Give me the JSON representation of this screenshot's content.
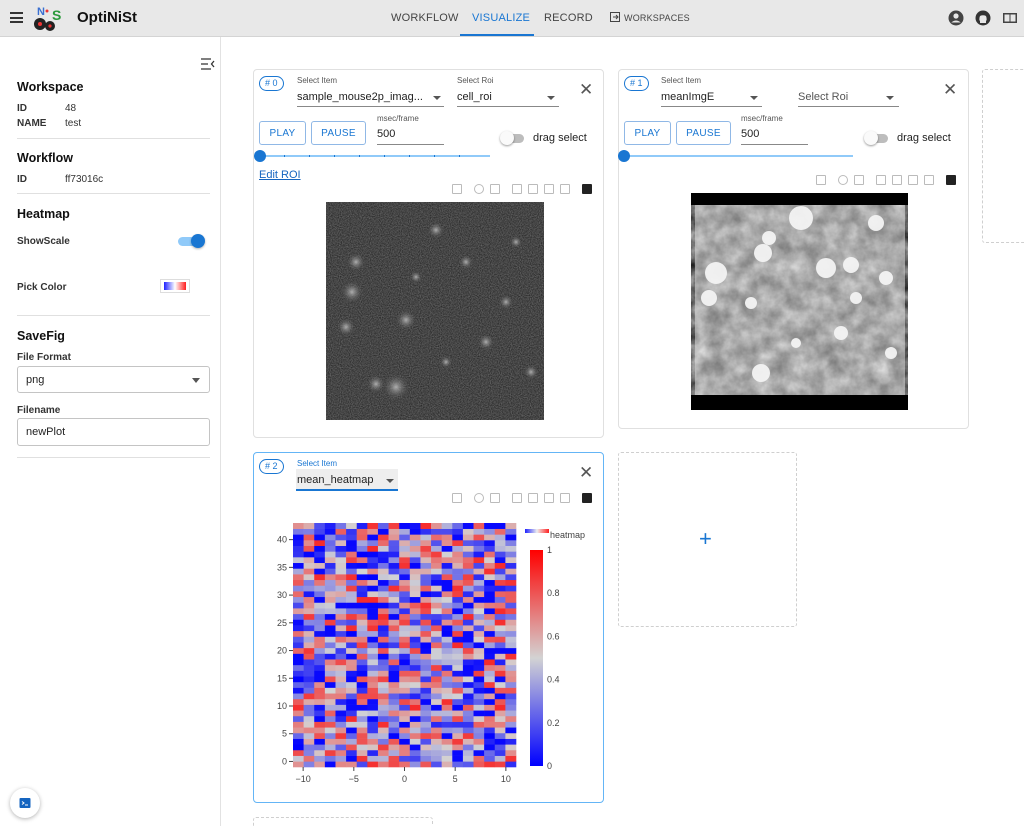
{
  "header": {
    "app_title": "OptiNiSt",
    "tabs": [
      {
        "label": "WORKFLOW"
      },
      {
        "label": "VISUALIZE"
      },
      {
        "label": "RECORD"
      },
      {
        "label": "WORKSPACES"
      }
    ],
    "active_tab": "VISUALIZE",
    "accent_color": "#1976d2"
  },
  "sidebar": {
    "workspace": {
      "title": "Workspace",
      "id_label": "ID",
      "id_value": "48",
      "name_label": "NAME",
      "name_value": "test"
    },
    "workflow": {
      "title": "Workflow",
      "id_label": "ID",
      "id_value": "ff73016c"
    },
    "heatmap": {
      "title": "Heatmap",
      "showscale_label": "ShowScale",
      "showscale_on": true,
      "pickcolor_label": "Pick Color"
    },
    "savefig": {
      "title": "SaveFig",
      "format_label": "File Format",
      "format_value": "png",
      "filename_label": "Filename",
      "filename_value": "newPlot"
    }
  },
  "panels": [
    {
      "badge": "# 0",
      "item_label": "Select Item",
      "item_value": "sample_mouse2p_imag...",
      "roi_label": "Select Roi",
      "roi_value": "cell_roi",
      "play": "PLAY",
      "pause": "PAUSE",
      "msec_label": "msec/frame",
      "msec_value": "500",
      "drag_label": "drag select",
      "edit_roi": "Edit ROI"
    },
    {
      "badge": "# 1",
      "item_label": "Select Item",
      "item_value": "meanImgE",
      "roi_placeholder": "Select Roi",
      "play": "PLAY",
      "pause": "PAUSE",
      "msec_label": "msec/frame",
      "msec_value": "500",
      "drag_label": "drag select"
    },
    {
      "badge": "# 2",
      "item_label": "Select Item",
      "item_value": "mean_heatmap"
    }
  ],
  "icons": [
    "menu-icon",
    "account-icon",
    "github-icon",
    "book-icon",
    "collapse-sidebar-icon",
    "camera-icon",
    "zoom-icon",
    "pan-icon",
    "zoom-in-icon",
    "zoom-out-icon",
    "autoscale-icon",
    "home-icon",
    "plotly-icon",
    "close-icon",
    "plus-icon",
    "terminal-icon",
    "workspaces-icon"
  ],
  "chart_data": {
    "type": "heatmap",
    "legend_label": "heatmap",
    "colorscale": [
      "#0000ff",
      "#d3d3d3",
      "#ff0000"
    ],
    "x_range": [
      -11,
      11
    ],
    "y_range": [
      -1,
      43
    ],
    "x_ticks": [
      -10,
      -5,
      0,
      5,
      10
    ],
    "x_tick_labels": [
      "−10",
      "−5",
      "0",
      "5",
      "10"
    ],
    "y_ticks": [
      0,
      5,
      10,
      15,
      20,
      25,
      30,
      35,
      40
    ],
    "colorbar_ticks": [
      0,
      0.2,
      0.4,
      0.6,
      0.8,
      1
    ],
    "zmin": 0,
    "zmax": 1,
    "x_count": 21,
    "y_count": 43,
    "note_values": "random-looking values in [0,1]"
  }
}
